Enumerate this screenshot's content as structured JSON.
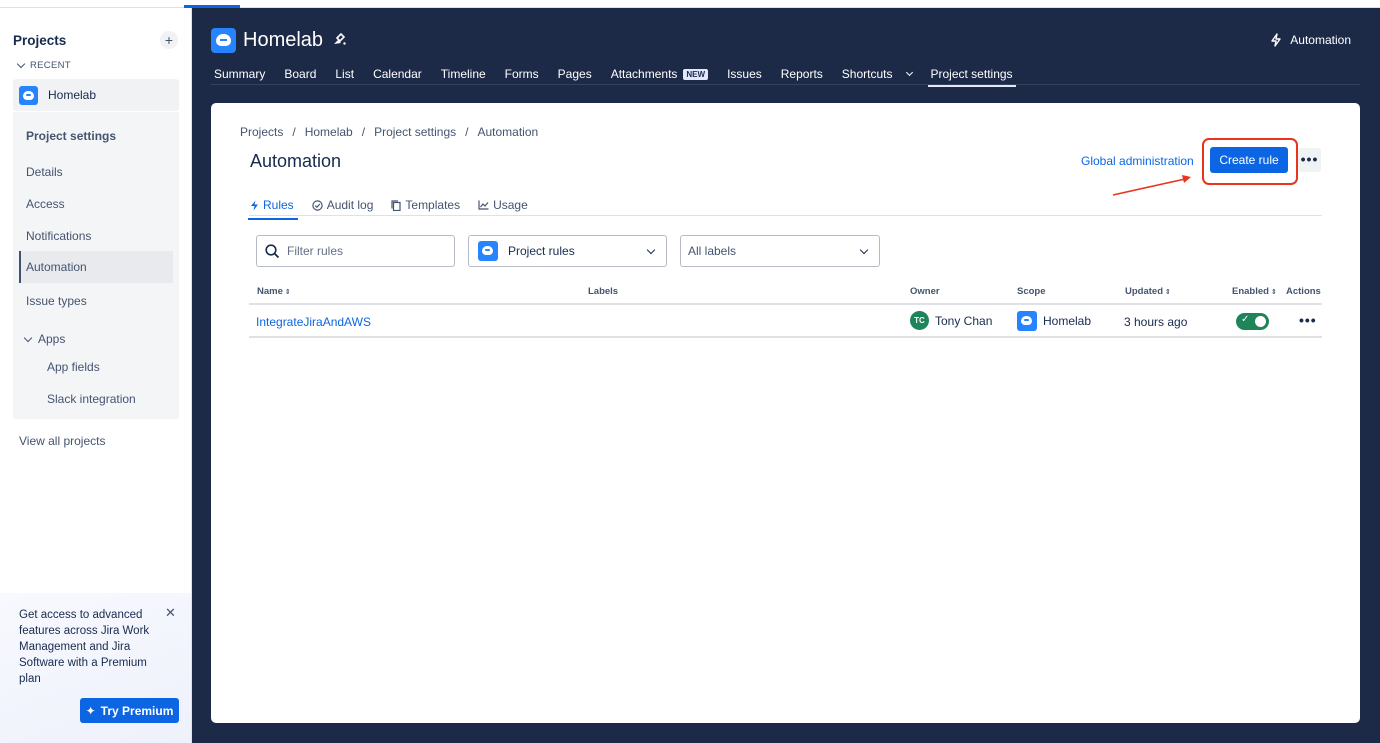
{
  "sidebar": {
    "title": "Projects",
    "add_icon": "plus-icon",
    "recent_label": "RECENT",
    "recent_project": "Homelab",
    "section_heading": "Project settings",
    "items": {
      "details": "Details",
      "access": "Access",
      "notifications": "Notifications",
      "automation": "Automation",
      "issue_types": "Issue types",
      "apps": "Apps",
      "app_fields": "App fields",
      "slack_integration": "Slack integration"
    },
    "view_all": "View all projects",
    "promo": {
      "text": "Get access to advanced features across Jira Work Management and Jira Software with a Premium plan",
      "button": "Try Premium"
    }
  },
  "header": {
    "project_title": "Homelab",
    "automation_label": "Automation",
    "nav": {
      "summary": "Summary",
      "board": "Board",
      "list": "List",
      "calendar": "Calendar",
      "timeline": "Timeline",
      "forms": "Forms",
      "pages": "Pages",
      "attachments": "Attachments",
      "new_badge": "NEW",
      "issues": "Issues",
      "reports": "Reports",
      "shortcuts": "Shortcuts",
      "project_settings": "Project settings"
    }
  },
  "main": {
    "breadcrumbs": [
      "Projects",
      "Homelab",
      "Project settings",
      "Automation"
    ],
    "breadcrumb_sep": "/",
    "title": "Automation",
    "global_admin": "Global administration",
    "create_rule": "Create rule",
    "more": "•••",
    "tabs": {
      "rules": "Rules",
      "audit_log": "Audit log",
      "templates": "Templates",
      "usage": "Usage"
    },
    "filter_placeholder": "Filter rules",
    "scope_select": "Project rules",
    "labels_select": "All labels",
    "columns": {
      "name": "Name",
      "labels": "Labels",
      "owner": "Owner",
      "scope": "Scope",
      "updated": "Updated",
      "enabled": "Enabled",
      "actions": "Actions"
    },
    "rules": [
      {
        "name": "IntegrateJiraAndAWS",
        "owner_initials": "TC",
        "owner": "Tony Chan",
        "scope": "Homelab",
        "updated": "3 hours ago",
        "enabled": true,
        "actions": "•••"
      }
    ]
  },
  "colors": {
    "accent": "#0c66e4",
    "header_bg": "#1d2a47",
    "enabled_green": "#1f845a",
    "annotation_red": "#e8341c"
  }
}
